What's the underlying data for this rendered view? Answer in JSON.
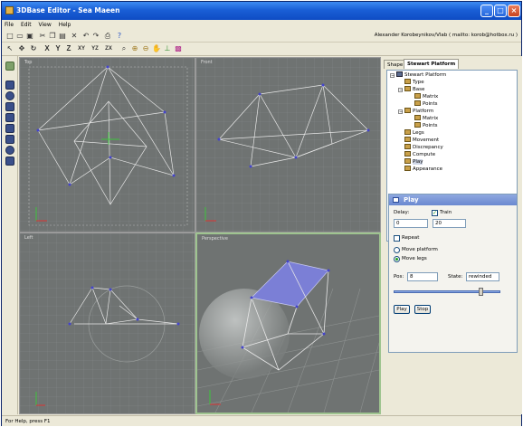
{
  "window": {
    "title": "3DBase Editor - Sea Maeen"
  },
  "menu": [
    "File",
    "Edit",
    "View",
    "Help"
  ],
  "toolbar": {
    "icons": [
      "new-icon",
      "open-icon",
      "save-icon",
      "cut-icon",
      "copy-icon",
      "paste-icon",
      "delete-icon",
      "undo-icon",
      "redo-icon",
      "print-icon",
      "help-icon"
    ],
    "author": "Alexander Korobeynikov/Vlab  ( mailto: korob@hotbox.ru )"
  },
  "toolbar2": {
    "tools": [
      "select-icon",
      "move-icon",
      "rotate-icon"
    ],
    "axes": [
      "X",
      "Y",
      "Z",
      "XY",
      "YZ",
      "ZX"
    ],
    "view_tools": [
      "zoom-icon",
      "zoom-in-icon",
      "zoom-out-icon",
      "pan-icon",
      "axes-icon",
      "render-icon"
    ]
  },
  "viewports": {
    "top": "Top",
    "front": "Front",
    "left": "Left",
    "perspective": "Perspective"
  },
  "panel": {
    "tabs": [
      "Shape",
      "Stewart Platform"
    ],
    "tree": [
      {
        "label": "Stewart Platform",
        "level": 0
      },
      {
        "label": "Type",
        "level": 1
      },
      {
        "label": "Base",
        "level": 1
      },
      {
        "label": "Matrix",
        "level": 2
      },
      {
        "label": "Points",
        "level": 2
      },
      {
        "label": "Platform",
        "level": 1
      },
      {
        "label": "Matrix",
        "level": 2
      },
      {
        "label": "Points",
        "level": 2
      },
      {
        "label": "Legs",
        "level": 1
      },
      {
        "label": "Movement",
        "level": 1
      },
      {
        "label": "Discrepancy",
        "level": 1
      },
      {
        "label": "Compute",
        "level": 1
      },
      {
        "label": "Play",
        "level": 1
      },
      {
        "label": "Appearance",
        "level": 1
      }
    ]
  },
  "play": {
    "title": "Play",
    "delay_label": "Delay:",
    "delay_value": "0",
    "train_label": "Train",
    "train_value": "20",
    "repeat_label": "Repeat",
    "move_platform_label": "Move platform",
    "move_legs_label": "Move legs",
    "pos_label": "Pos:",
    "pos_value": "8",
    "state_label": "State:",
    "state_value": "rewinded",
    "slider_fraction": 0.82,
    "play_button": "Play",
    "stop_button": "Stop"
  },
  "status": "For Help, press F1"
}
